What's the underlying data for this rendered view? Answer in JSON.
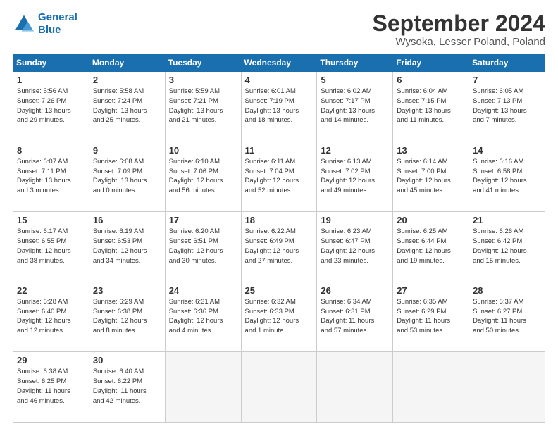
{
  "header": {
    "logo_line1": "General",
    "logo_line2": "Blue",
    "title": "September 2024",
    "subtitle": "Wysoka, Lesser Poland, Poland"
  },
  "weekdays": [
    "Sunday",
    "Monday",
    "Tuesday",
    "Wednesday",
    "Thursday",
    "Friday",
    "Saturday"
  ],
  "weeks": [
    [
      {
        "day": "1",
        "info": "Sunrise: 5:56 AM\nSunset: 7:26 PM\nDaylight: 13 hours\nand 29 minutes."
      },
      {
        "day": "2",
        "info": "Sunrise: 5:58 AM\nSunset: 7:24 PM\nDaylight: 13 hours\nand 25 minutes."
      },
      {
        "day": "3",
        "info": "Sunrise: 5:59 AM\nSunset: 7:21 PM\nDaylight: 13 hours\nand 21 minutes."
      },
      {
        "day": "4",
        "info": "Sunrise: 6:01 AM\nSunset: 7:19 PM\nDaylight: 13 hours\nand 18 minutes."
      },
      {
        "day": "5",
        "info": "Sunrise: 6:02 AM\nSunset: 7:17 PM\nDaylight: 13 hours\nand 14 minutes."
      },
      {
        "day": "6",
        "info": "Sunrise: 6:04 AM\nSunset: 7:15 PM\nDaylight: 13 hours\nand 11 minutes."
      },
      {
        "day": "7",
        "info": "Sunrise: 6:05 AM\nSunset: 7:13 PM\nDaylight: 13 hours\nand 7 minutes."
      }
    ],
    [
      {
        "day": "8",
        "info": "Sunrise: 6:07 AM\nSunset: 7:11 PM\nDaylight: 13 hours\nand 3 minutes."
      },
      {
        "day": "9",
        "info": "Sunrise: 6:08 AM\nSunset: 7:09 PM\nDaylight: 13 hours\nand 0 minutes."
      },
      {
        "day": "10",
        "info": "Sunrise: 6:10 AM\nSunset: 7:06 PM\nDaylight: 12 hours\nand 56 minutes."
      },
      {
        "day": "11",
        "info": "Sunrise: 6:11 AM\nSunset: 7:04 PM\nDaylight: 12 hours\nand 52 minutes."
      },
      {
        "day": "12",
        "info": "Sunrise: 6:13 AM\nSunset: 7:02 PM\nDaylight: 12 hours\nand 49 minutes."
      },
      {
        "day": "13",
        "info": "Sunrise: 6:14 AM\nSunset: 7:00 PM\nDaylight: 12 hours\nand 45 minutes."
      },
      {
        "day": "14",
        "info": "Sunrise: 6:16 AM\nSunset: 6:58 PM\nDaylight: 12 hours\nand 41 minutes."
      }
    ],
    [
      {
        "day": "15",
        "info": "Sunrise: 6:17 AM\nSunset: 6:55 PM\nDaylight: 12 hours\nand 38 minutes."
      },
      {
        "day": "16",
        "info": "Sunrise: 6:19 AM\nSunset: 6:53 PM\nDaylight: 12 hours\nand 34 minutes."
      },
      {
        "day": "17",
        "info": "Sunrise: 6:20 AM\nSunset: 6:51 PM\nDaylight: 12 hours\nand 30 minutes."
      },
      {
        "day": "18",
        "info": "Sunrise: 6:22 AM\nSunset: 6:49 PM\nDaylight: 12 hours\nand 27 minutes."
      },
      {
        "day": "19",
        "info": "Sunrise: 6:23 AM\nSunset: 6:47 PM\nDaylight: 12 hours\nand 23 minutes."
      },
      {
        "day": "20",
        "info": "Sunrise: 6:25 AM\nSunset: 6:44 PM\nDaylight: 12 hours\nand 19 minutes."
      },
      {
        "day": "21",
        "info": "Sunrise: 6:26 AM\nSunset: 6:42 PM\nDaylight: 12 hours\nand 15 minutes."
      }
    ],
    [
      {
        "day": "22",
        "info": "Sunrise: 6:28 AM\nSunset: 6:40 PM\nDaylight: 12 hours\nand 12 minutes."
      },
      {
        "day": "23",
        "info": "Sunrise: 6:29 AM\nSunset: 6:38 PM\nDaylight: 12 hours\nand 8 minutes."
      },
      {
        "day": "24",
        "info": "Sunrise: 6:31 AM\nSunset: 6:36 PM\nDaylight: 12 hours\nand 4 minutes."
      },
      {
        "day": "25",
        "info": "Sunrise: 6:32 AM\nSunset: 6:33 PM\nDaylight: 12 hours\nand 1 minute."
      },
      {
        "day": "26",
        "info": "Sunrise: 6:34 AM\nSunset: 6:31 PM\nDaylight: 11 hours\nand 57 minutes."
      },
      {
        "day": "27",
        "info": "Sunrise: 6:35 AM\nSunset: 6:29 PM\nDaylight: 11 hours\nand 53 minutes."
      },
      {
        "day": "28",
        "info": "Sunrise: 6:37 AM\nSunset: 6:27 PM\nDaylight: 11 hours\nand 50 minutes."
      }
    ],
    [
      {
        "day": "29",
        "info": "Sunrise: 6:38 AM\nSunset: 6:25 PM\nDaylight: 11 hours\nand 46 minutes."
      },
      {
        "day": "30",
        "info": "Sunrise: 6:40 AM\nSunset: 6:22 PM\nDaylight: 11 hours\nand 42 minutes."
      },
      null,
      null,
      null,
      null,
      null
    ]
  ]
}
